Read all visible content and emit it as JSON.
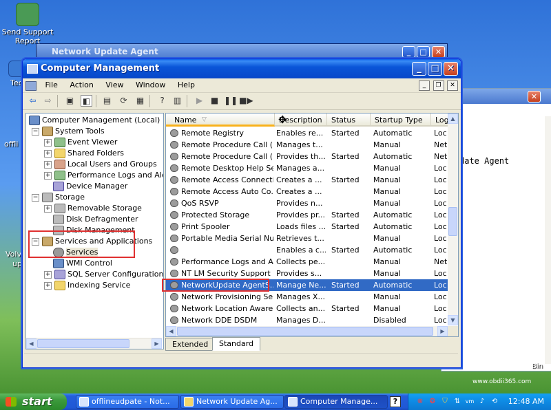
{
  "desktop": {
    "icon1_line1": "Send Support",
    "icon1_line2": "Report",
    "partial_tec": "Tec",
    "partial_offli": "offli",
    "partial_volv": "Volv",
    "partial_up": "up",
    "right_win_text": "date Agent",
    "watermark": "www.obdii365.com",
    "partial_bin": "Bin"
  },
  "bg_window": {
    "title": "Network Update Agent"
  },
  "window": {
    "title": "Computer Management",
    "menu": [
      "File",
      "Action",
      "View",
      "Window",
      "Help"
    ]
  },
  "tree": {
    "root": "Computer Management (Local)",
    "system_tools": "System Tools",
    "event_viewer": "Event Viewer",
    "shared_folders": "Shared Folders",
    "local_users": "Local Users and Groups",
    "perf_logs": "Performance Logs and Alerts",
    "device_manager": "Device Manager",
    "storage": "Storage",
    "removable_storage": "Removable Storage",
    "disk_defrag": "Disk Defragmenter",
    "disk_mgmt": "Disk Management",
    "services_apps": "Services and Applications",
    "services": "Services",
    "wmi": "WMI Control",
    "sql": "SQL Server Configuration Manager",
    "indexing": "Indexing Service"
  },
  "list": {
    "columns": [
      "Name",
      "Description",
      "Status",
      "Startup Type",
      "Log"
    ],
    "rows": [
      {
        "name": "Remote Registry",
        "desc": "Enables re...",
        "status": "Started",
        "startup": "Automatic",
        "log": "Loc"
      },
      {
        "name": "Remote Procedure Call (...",
        "desc": "Manages t...",
        "status": "",
        "startup": "Manual",
        "log": "Net"
      },
      {
        "name": "Remote Procedure Call (...",
        "desc": "Provides th...",
        "status": "Started",
        "startup": "Automatic",
        "log": "Net"
      },
      {
        "name": "Remote Desktop Help Se...",
        "desc": "Manages a...",
        "status": "",
        "startup": "Manual",
        "log": "Loc"
      },
      {
        "name": "Remote Access Connecti...",
        "desc": "Creates a ...",
        "status": "Started",
        "startup": "Manual",
        "log": "Loc"
      },
      {
        "name": "Remote Access Auto Co...",
        "desc": "Creates a ...",
        "status": "",
        "startup": "Manual",
        "log": "Loc"
      },
      {
        "name": "QoS RSVP",
        "desc": "Provides n...",
        "status": "",
        "startup": "Manual",
        "log": "Loc"
      },
      {
        "name": "Protected Storage",
        "desc": "Provides pr...",
        "status": "Started",
        "startup": "Automatic",
        "log": "Loc"
      },
      {
        "name": "Print Spooler",
        "desc": "Loads files ...",
        "status": "Started",
        "startup": "Automatic",
        "log": "Loc"
      },
      {
        "name": "Portable Media Serial Nu...",
        "desc": "Retrieves t...",
        "status": "",
        "startup": "Manual",
        "log": "Loc"
      },
      {
        "name": "",
        "desc": "Enables a c...",
        "status": "Started",
        "startup": "Automatic",
        "log": "Loc"
      },
      {
        "name": "Performance Logs and A...",
        "desc": "Collects pe...",
        "status": "",
        "startup": "Manual",
        "log": "Net"
      },
      {
        "name": "NT LM Security Support ...",
        "desc": "Provides s...",
        "status": "",
        "startup": "Manual",
        "log": "Loc"
      },
      {
        "name": "NetworkUpdate AgentS...",
        "desc": "Manage Ne...",
        "status": "Started",
        "startup": "Automatic",
        "log": "Loc"
      },
      {
        "name": "Network Provisioning Se...",
        "desc": "Manages X...",
        "status": "",
        "startup": "Manual",
        "log": "Loc"
      },
      {
        "name": "Network Location Aware...",
        "desc": "Collects an...",
        "status": "Started",
        "startup": "Manual",
        "log": "Loc"
      },
      {
        "name": "Network DDE DSDM",
        "desc": "Manages D...",
        "status": "",
        "startup": "Disabled",
        "log": "Loc"
      }
    ],
    "selected_index": 13
  },
  "tabs": [
    "Extended",
    "Standard"
  ],
  "taskbar": {
    "start": "start",
    "tasks": [
      "offlineudpate - Not...",
      "Network Update Ag...",
      "Computer Manage..."
    ],
    "clock": "12:48 AM"
  }
}
